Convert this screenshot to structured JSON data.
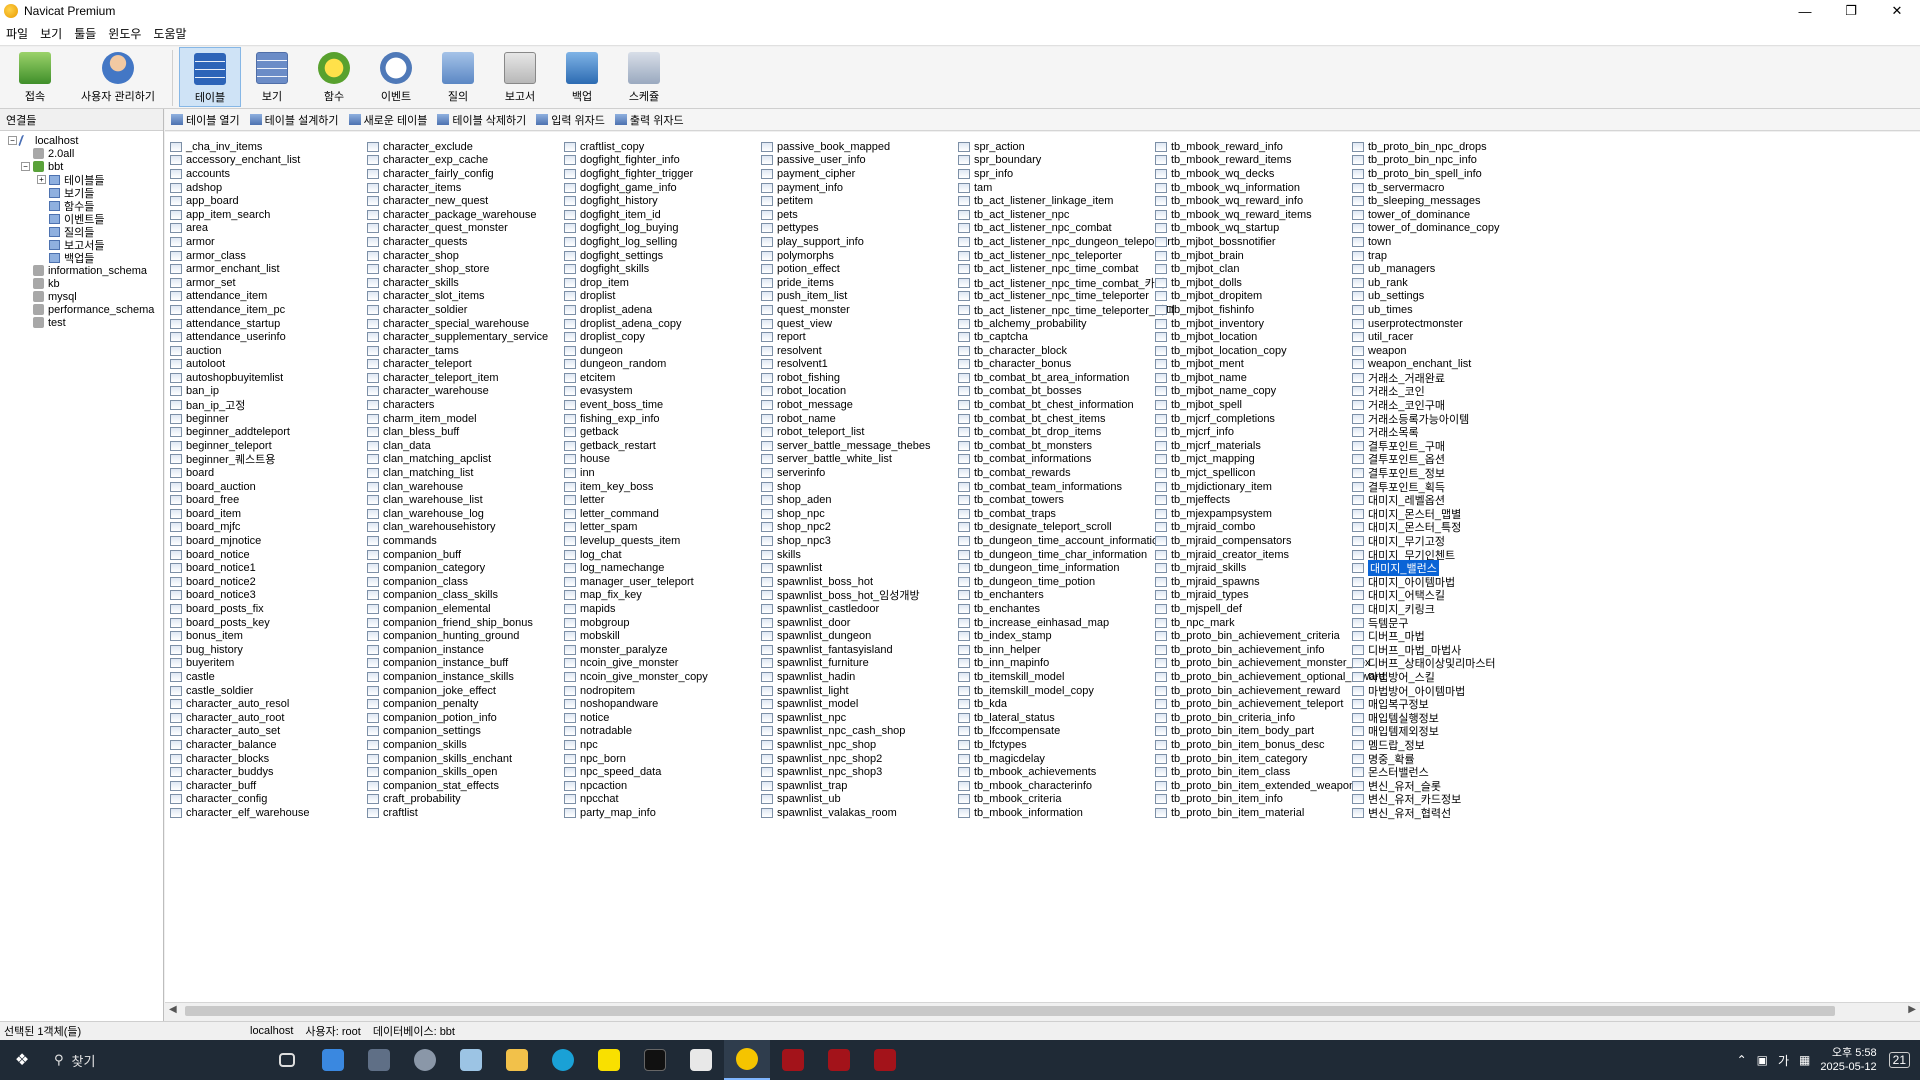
{
  "window": {
    "title": "Navicat Premium"
  },
  "menu": [
    "파일",
    "보기",
    "툴들",
    "윈도우",
    "도움말"
  ],
  "toolbar": {
    "connect": "접속",
    "user_admin": "사용자 관리하기",
    "buttons": [
      "테이블",
      "보기",
      "함수",
      "이벤트",
      "질의",
      "보고서",
      "백업",
      "스케쥴"
    ]
  },
  "left_panel": {
    "header": "연결들",
    "host": "localhost",
    "dbs_before": [
      "2.0all"
    ],
    "active_db": "bbt",
    "active_children": [
      "테이블들",
      "보기들",
      "함수들",
      "이벤트들",
      "질의들",
      "보고서들",
      "백업들"
    ],
    "dbs_after": [
      "information_schema",
      "kb",
      "mysql",
      "performance_schema",
      "test"
    ]
  },
  "object_bar": [
    "테이블 열기",
    "테이블 설계하기",
    "새로운 테이블",
    "테이블 삭제하기",
    "입력 위자드",
    "출력 위자드"
  ],
  "columns": [
    [
      "_cha_inv_items",
      "accessory_enchant_list",
      "accounts",
      "adshop",
      "app_board",
      "app_item_search",
      "area",
      "armor",
      "armor_class",
      "armor_enchant_list",
      "armor_set",
      "attendance_item",
      "attendance_item_pc",
      "attendance_startup",
      "attendance_userinfo",
      "auction",
      "autoloot",
      "autoshopbuyitemlist",
      "ban_ip",
      "ban_ip_고정",
      "beginner",
      "beginner_addteleport",
      "beginner_teleport",
      "beginner_퀘스트용",
      "board",
      "board_auction",
      "board_free",
      "board_item",
      "board_mjfc",
      "board_mjnotice",
      "board_notice",
      "board_notice1",
      "board_notice2",
      "board_notice3",
      "board_posts_fix",
      "board_posts_key",
      "bonus_item",
      "bug_history",
      "buyeritem",
      "castle",
      "castle_soldier",
      "character_auto_resol",
      "character_auto_root",
      "character_auto_set",
      "character_balance",
      "character_blocks",
      "character_buddys",
      "character_buff",
      "character_config",
      "character_elf_warehouse"
    ],
    [
      "character_exclude",
      "character_exp_cache",
      "character_fairly_config",
      "character_items",
      "character_new_quest",
      "character_package_warehouse",
      "character_quest_monster",
      "character_quests",
      "character_shop",
      "character_shop_store",
      "character_skills",
      "character_slot_items",
      "character_soldier",
      "character_special_warehouse",
      "character_supplementary_service",
      "character_tams",
      "character_teleport",
      "character_teleport_item",
      "character_warehouse",
      "characters",
      "charm_item_model",
      "clan_bless_buff",
      "clan_data",
      "clan_matching_apclist",
      "clan_matching_list",
      "clan_warehouse",
      "clan_warehouse_list",
      "clan_warehouse_log",
      "clan_warehousehistory",
      "commands",
      "companion_buff",
      "companion_category",
      "companion_class",
      "companion_class_skills",
      "companion_elemental",
      "companion_friend_ship_bonus",
      "companion_hunting_ground",
      "companion_instance",
      "companion_instance_buff",
      "companion_instance_skills",
      "companion_joke_effect",
      "companion_penalty",
      "companion_potion_info",
      "companion_settings",
      "companion_skills",
      "companion_skills_enchant",
      "companion_skills_open",
      "companion_stat_effects",
      "craft_probability",
      "craftlist"
    ],
    [
      "craftlist_copy",
      "dogfight_fighter_info",
      "dogfight_fighter_trigger",
      "dogfight_game_info",
      "dogfight_history",
      "dogfight_item_id",
      "dogfight_log_buying",
      "dogfight_log_selling",
      "dogfight_settings",
      "dogfight_skills",
      "drop_item",
      "droplist",
      "droplist_adena",
      "droplist_adena_copy",
      "droplist_copy",
      "dungeon",
      "dungeon_random",
      "etcitem",
      "evasystem",
      "event_boss_time",
      "fishing_exp_info",
      "getback",
      "getback_restart",
      "house",
      "inn",
      "item_key_boss",
      "letter",
      "letter_command",
      "letter_spam",
      "levelup_quests_item",
      "log_chat",
      "log_namechange",
      "manager_user_teleport",
      "map_fix_key",
      "mapids",
      "mobgroup",
      "mobskill",
      "monster_paralyze",
      "ncoin_give_monster",
      "ncoin_give_monster_copy",
      "nodropitem",
      "noshopandware",
      "notice",
      "notradable",
      "npc",
      "npc_born",
      "npc_speed_data",
      "npcaction",
      "npcchat",
      "party_map_info"
    ],
    [
      "passive_book_mapped",
      "passive_user_info",
      "payment_cipher",
      "payment_info",
      "petitem",
      "pets",
      "pettypes",
      "play_support_info",
      "polymorphs",
      "potion_effect",
      "pride_items",
      "push_item_list",
      "quest_monster",
      "quest_view",
      "report",
      "resolvent",
      "resolvent1",
      "robot_fishing",
      "robot_location",
      "robot_message",
      "robot_name",
      "robot_teleport_list",
      "server_battle_message_thebes",
      "server_battle_white_list",
      "serverinfo",
      "shop",
      "shop_aden",
      "shop_npc",
      "shop_npc2",
      "shop_npc3",
      "skills",
      "spawnlist",
      "spawnlist_boss_hot",
      "spawnlist_boss_hot_임성개방",
      "spawnlist_castledoor",
      "spawnlist_door",
      "spawnlist_dungeon",
      "spawnlist_fantasyisland",
      "spawnlist_furniture",
      "spawnlist_hadin",
      "spawnlist_light",
      "spawnlist_model",
      "spawnlist_npc",
      "spawnlist_npc_cash_shop",
      "spawnlist_npc_shop",
      "spawnlist_npc_shop2",
      "spawnlist_npc_shop3",
      "spawnlist_trap",
      "spawnlist_ub",
      "spawnlist_valakas_room"
    ],
    [
      "spr_action",
      "spr_boundary",
      "spr_info",
      "tam",
      "tb_act_listener_linkage_item",
      "tb_act_listener_npc",
      "tb_act_listener_npc_combat",
      "tb_act_listener_npc_dungeon_teleporter",
      "tb_act_listener_npc_teleporter",
      "tb_act_listener_npc_time_combat",
      "tb_act_listener_npc_time_combat_카피",
      "tb_act_listener_npc_time_teleporter",
      "tb_act_listener_npc_time_teleporter_카피",
      "tb_alchemy_probability",
      "tb_captcha",
      "tb_character_block",
      "tb_character_bonus",
      "tb_combat_bt_area_information",
      "tb_combat_bt_bosses",
      "tb_combat_bt_chest_information",
      "tb_combat_bt_chest_items",
      "tb_combat_bt_drop_items",
      "tb_combat_bt_monsters",
      "tb_combat_informations",
      "tb_combat_rewards",
      "tb_combat_team_informations",
      "tb_combat_towers",
      "tb_combat_traps",
      "tb_designate_teleport_scroll",
      "tb_dungeon_time_account_information",
      "tb_dungeon_time_char_information",
      "tb_dungeon_time_information",
      "tb_dungeon_time_potion",
      "tb_enchanters",
      "tb_enchantes",
      "tb_increase_einhasad_map",
      "tb_index_stamp",
      "tb_inn_helper",
      "tb_inn_mapinfo",
      "tb_itemskill_model",
      "tb_itemskill_model_copy",
      "tb_kda",
      "tb_lateral_status",
      "tb_lfccompensate",
      "tb_lfctypes",
      "tb_magicdelay",
      "tb_mbook_achievements",
      "tb_mbook_characterinfo",
      "tb_mbook_criteria",
      "tb_mbook_information"
    ],
    [
      "tb_mbook_reward_info",
      "tb_mbook_reward_items",
      "tb_mbook_wq_decks",
      "tb_mbook_wq_information",
      "tb_mbook_wq_reward_info",
      "tb_mbook_wq_reward_items",
      "tb_mbook_wq_startup",
      "tb_mjbot_bossnotifier",
      "tb_mjbot_brain",
      "tb_mjbot_clan",
      "tb_mjbot_dolls",
      "tb_mjbot_dropitem",
      "tb_mjbot_fishinfo",
      "tb_mjbot_inventory",
      "tb_mjbot_location",
      "tb_mjbot_location_copy",
      "tb_mjbot_ment",
      "tb_mjbot_name",
      "tb_mjbot_name_copy",
      "tb_mjbot_spell",
      "tb_mjcrf_completions",
      "tb_mjcrf_info",
      "tb_mjcrf_materials",
      "tb_mjct_mapping",
      "tb_mjct_spellicon",
      "tb_mjdictionary_item",
      "tb_mjeffects",
      "tb_mjexpampsystem",
      "tb_mjraid_combo",
      "tb_mjraid_compensators",
      "tb_mjraid_creator_items",
      "tb_mjraid_skills",
      "tb_mjraid_spawns",
      "tb_mjraid_types",
      "tb_mjspell_def",
      "tb_npc_mark",
      "tb_proto_bin_achievement_criteria",
      "tb_proto_bin_achievement_info",
      "tb_proto_bin_achievement_monster_dex",
      "tb_proto_bin_achievement_optional_reward",
      "tb_proto_bin_achievement_reward",
      "tb_proto_bin_achievement_teleport",
      "tb_proto_bin_criteria_info",
      "tb_proto_bin_item_body_part",
      "tb_proto_bin_item_bonus_desc",
      "tb_proto_bin_item_category",
      "tb_proto_bin_item_class",
      "tb_proto_bin_item_extended_weapon",
      "tb_proto_bin_item_info",
      "tb_proto_bin_item_material"
    ],
    [
      "tb_proto_bin_npc_drops",
      "tb_proto_bin_npc_info",
      "tb_proto_bin_spell_info",
      "tb_servermacro",
      "tb_sleeping_messages",
      "tower_of_dominance",
      "tower_of_dominance_copy",
      "town",
      "trap",
      "ub_managers",
      "ub_rank",
      "ub_settings",
      "ub_times",
      "userprotectmonster",
      "util_racer",
      "weapon",
      "weapon_enchant_list",
      "거래소_거래완료",
      "거래소_코인",
      "거래소_코인구매",
      "거래소등록가능아이템",
      "거래소목록",
      "결투포인트_구매",
      "결투포인트_옵션",
      "결투포인트_정보",
      "결투포인트_획득",
      "대미지_레벨옵션",
      "대미지_몬스터_맵별",
      "대미지_몬스터_특정",
      "대미지_무기고정",
      "대미지_무기인첸트",
      "대미지_밸런스",
      "대미지_아이템마법",
      "대미지_어택스킬",
      "대미지_키링크",
      "득템문구",
      "디버프_마법",
      "디버프_마법_마법사",
      "디버프_상태이상및리마스터",
      "마법방어_스킬",
      "마법방어_아이템마법",
      "매입복구정보",
      "매입템실행정보",
      "매입템제외정보",
      "멤드랍_정보",
      "명중_확률",
      "몬스터밸런스",
      "변신_유저_슬롯",
      "변신_유저_카드정보",
      "변신_유저_협력선"
    ]
  ],
  "selected_item": "대미지_밸런스",
  "status": {
    "selected": "선택된 1객체(들)",
    "host": "localhost",
    "user": "사용자: root",
    "database": "데이터베이스: bbt"
  },
  "taskbar": {
    "search": "찾기",
    "ime": "가",
    "time": "오후 5:58",
    "date": "2025-05-12",
    "notif": "21"
  }
}
